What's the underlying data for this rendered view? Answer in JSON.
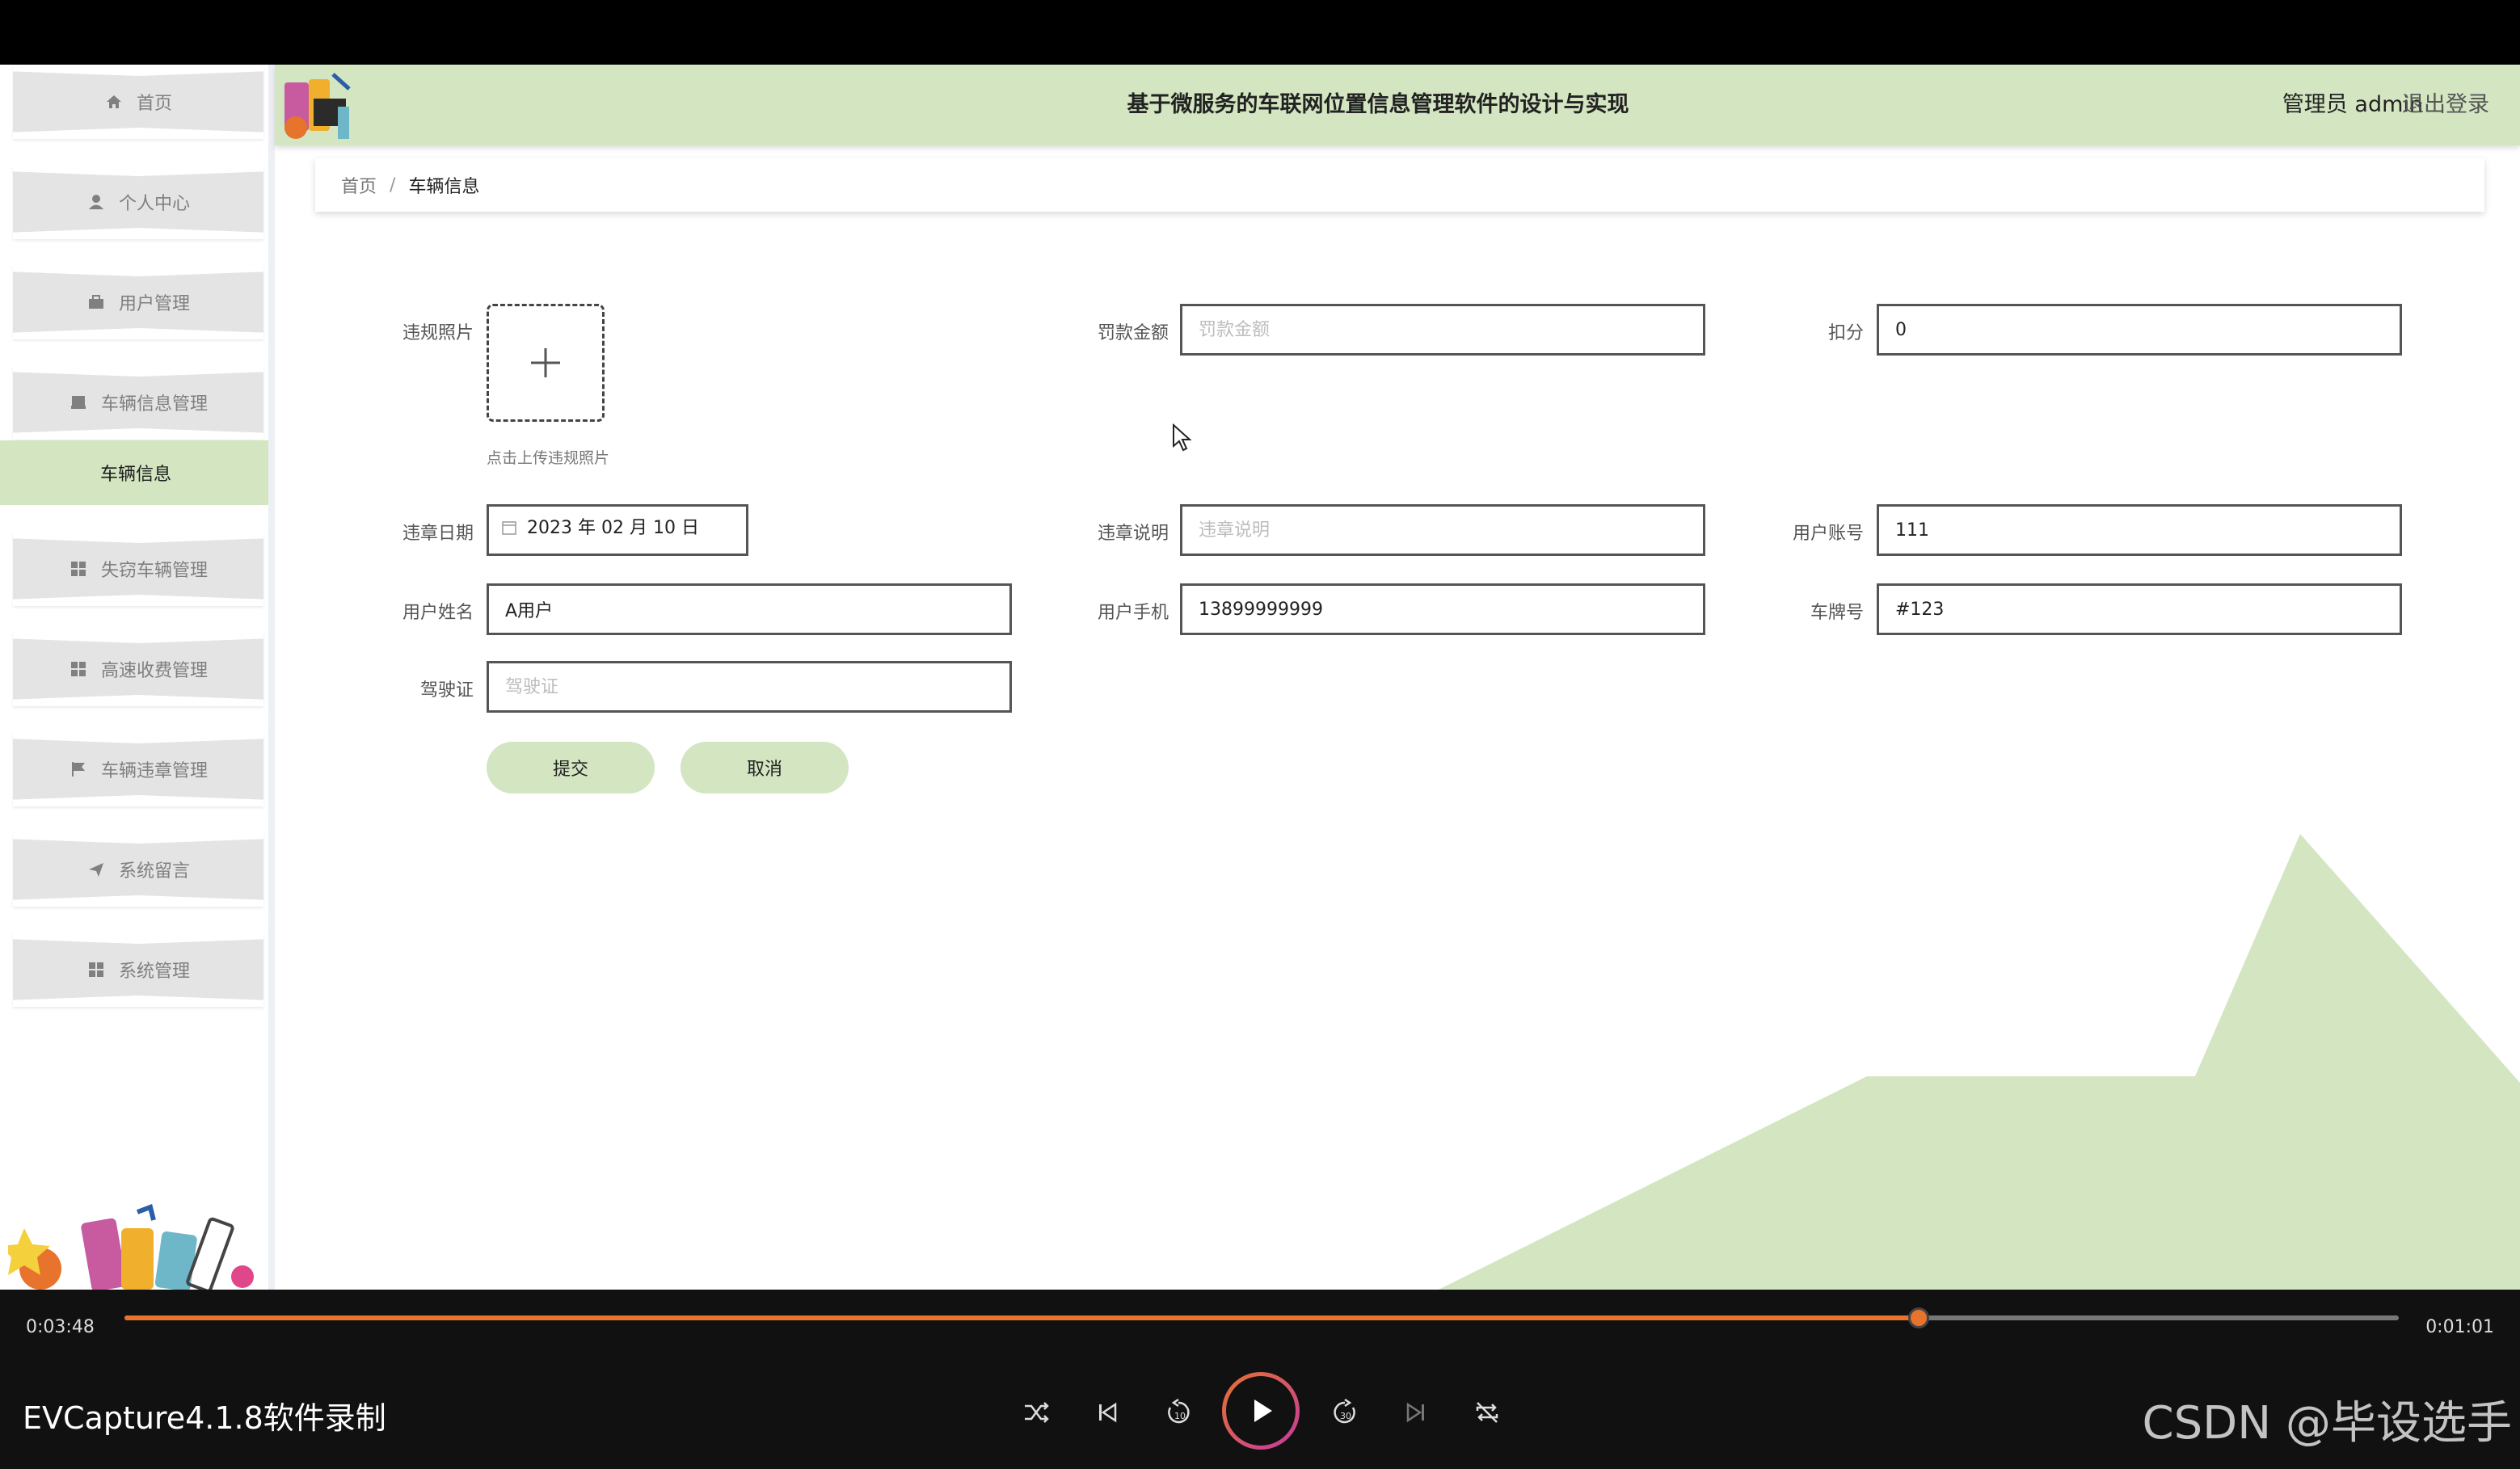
{
  "header": {
    "title": "基于微服务的车联网位置信息管理软件的设计与实现",
    "user": "管理员 admin",
    "logout": "退出登录"
  },
  "sidebar": {
    "items": [
      {
        "label": "首页",
        "icon": "home-icon"
      },
      {
        "label": "个人中心",
        "icon": "user-icon"
      },
      {
        "label": "用户管理",
        "icon": "briefcase-icon"
      },
      {
        "label": "车辆信息管理",
        "icon": "inbox-icon"
      },
      {
        "label": "失窃车辆管理",
        "icon": "grid-icon"
      },
      {
        "label": "高速收费管理",
        "icon": "grid-icon"
      },
      {
        "label": "车辆违章管理",
        "icon": "flag-icon"
      },
      {
        "label": "系统留言",
        "icon": "paper-plane-icon"
      },
      {
        "label": "系统管理",
        "icon": "grid-icon"
      }
    ],
    "active_sub": "车辆信息"
  },
  "breadcrumb": {
    "home": "首页",
    "separator": "/",
    "current": "车辆信息"
  },
  "form": {
    "photo": {
      "label": "违规照片",
      "hint": "点击上传违规照片"
    },
    "fine": {
      "label": "罚款金额",
      "placeholder": "罚款金额",
      "value": ""
    },
    "points": {
      "label": "扣分",
      "value": "0"
    },
    "date": {
      "label": "违章日期",
      "value": "2023 年 02 月 10 日"
    },
    "description": {
      "label": "违章说明",
      "placeholder": "违章说明",
      "value": ""
    },
    "account": {
      "label": "用户账号",
      "value": "111"
    },
    "name": {
      "label": "用户姓名",
      "value": "A用户"
    },
    "phone": {
      "label": "用户手机",
      "value": "13899999999"
    },
    "plate": {
      "label": "车牌号",
      "value": "#123"
    },
    "license": {
      "label": "驾驶证",
      "placeholder": "驾驶证",
      "value": ""
    },
    "submit": "提交",
    "cancel": "取消"
  },
  "player": {
    "elapsed": "0:03:48",
    "remaining": "0:01:01",
    "progress": 0.789,
    "recorder": "EVCapture4.1.8软件录制",
    "watermark": "CSDN @毕设选手"
  },
  "colors": {
    "accent_green": "#d3e5c1",
    "progress_orange": "#e8732d"
  }
}
